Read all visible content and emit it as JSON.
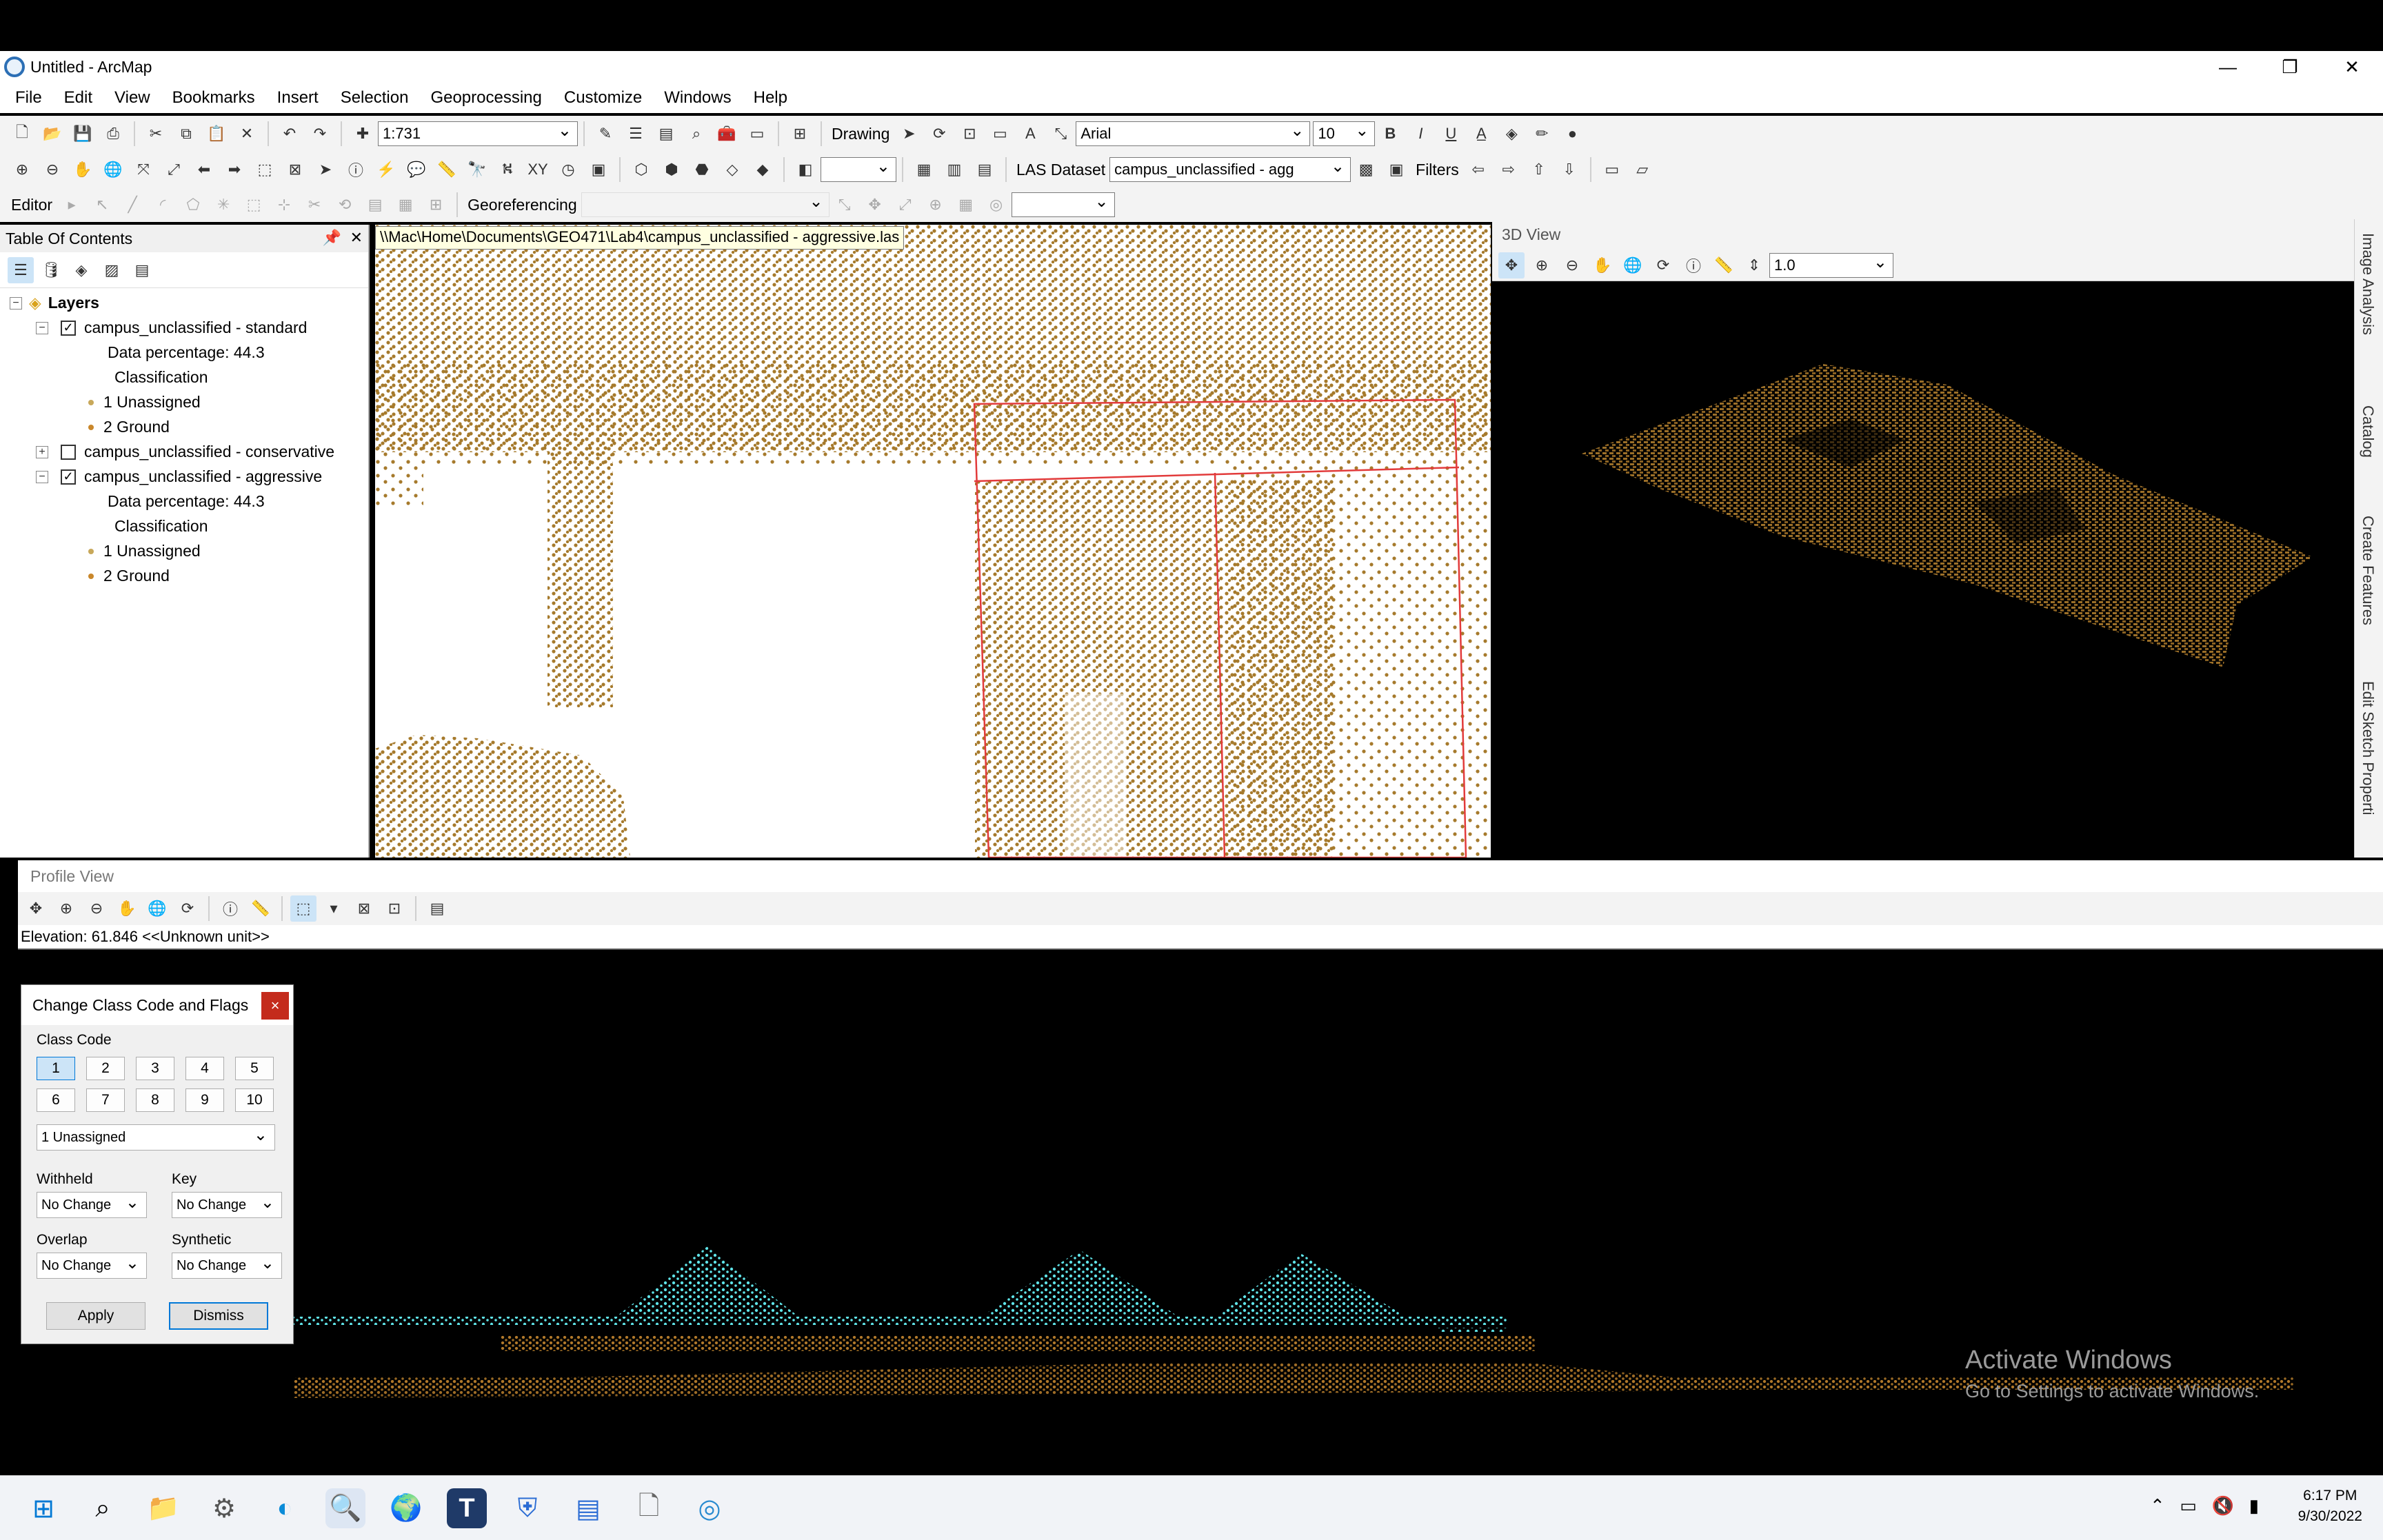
{
  "window": {
    "title": "Untitled - ArcMap",
    "controls": [
      "—",
      "❐",
      "✕"
    ]
  },
  "menu": [
    "File",
    "Edit",
    "View",
    "Bookmarks",
    "Insert",
    "Selection",
    "Geoprocessing",
    "Customize",
    "Windows",
    "Help"
  ],
  "toolbar": {
    "scale": "1:731",
    "drawing_label": "Drawing",
    "font_name": "Arial",
    "font_size": "10",
    "bold": "B",
    "italic": "I",
    "underline": "U",
    "las_dataset_label": "LAS Dataset",
    "las_layer": "campus_unclassified - agg",
    "filters_label": "Filters",
    "editor_label": "Editor",
    "georef_label": "Georeferencing"
  },
  "toc": {
    "title": "Table Of Contents",
    "root": "Layers",
    "layers": [
      {
        "name": "campus_unclassified - standard",
        "checked": true,
        "expanded": true,
        "data_pct": "Data percentage: 44.3",
        "class_heading": "Classification",
        "classes": [
          {
            "label": "1  Unassigned",
            "color": "#c8a85a"
          },
          {
            "label": "2  Ground",
            "color": "#c9872b"
          }
        ]
      },
      {
        "name": "campus_unclassified - conservative",
        "checked": false,
        "expanded": false
      },
      {
        "name": "campus_unclassified - aggressive",
        "checked": true,
        "expanded": true,
        "data_pct": "Data percentage: 44.3",
        "class_heading": "Classification",
        "classes": [
          {
            "label": "1  Unassigned",
            "color": "#c8a85a"
          },
          {
            "label": "2  Ground",
            "color": "#c9872b"
          }
        ]
      }
    ]
  },
  "map": {
    "path": "\\\\Mac\\Home\\Documents\\GEO471\\Lab4\\campus_unclassified - aggressive.las",
    "point_color": "#a67a2c",
    "select_color": "#e23b3b"
  },
  "view3d": {
    "title": "3D View",
    "exaggeration": "1.0"
  },
  "right_dock": [
    "Image Analysis",
    "Catalog",
    "Create Features",
    "Edit Sketch Properti"
  ],
  "profile": {
    "title": "Profile View",
    "status": "Elevation: 61.846 <<Unknown unit>>",
    "cyan": "#5fe3e8",
    "ground": "#b0782a"
  },
  "dialog": {
    "title": "Change Class Code and Flags",
    "close": "×",
    "class_code_label": "Class Code",
    "codes": [
      "1",
      "2",
      "3",
      "4",
      "5",
      "6",
      "7",
      "8",
      "9",
      "10"
    ],
    "selected_code": "1 Unassigned",
    "withheld_label": "Withheld",
    "withheld_value": "No Change",
    "key_label": "Key",
    "key_value": "No Change",
    "overlap_label": "Overlap",
    "overlap_value": "No Change",
    "synthetic_label": "Synthetic",
    "synthetic_value": "No Change",
    "apply": "Apply",
    "dismiss": "Dismiss"
  },
  "watermark": {
    "line1": "Activate Windows",
    "line2": "Go to Settings to activate Windows."
  },
  "taskbar": {
    "time": "6:17 PM",
    "date": "9/30/2022"
  }
}
